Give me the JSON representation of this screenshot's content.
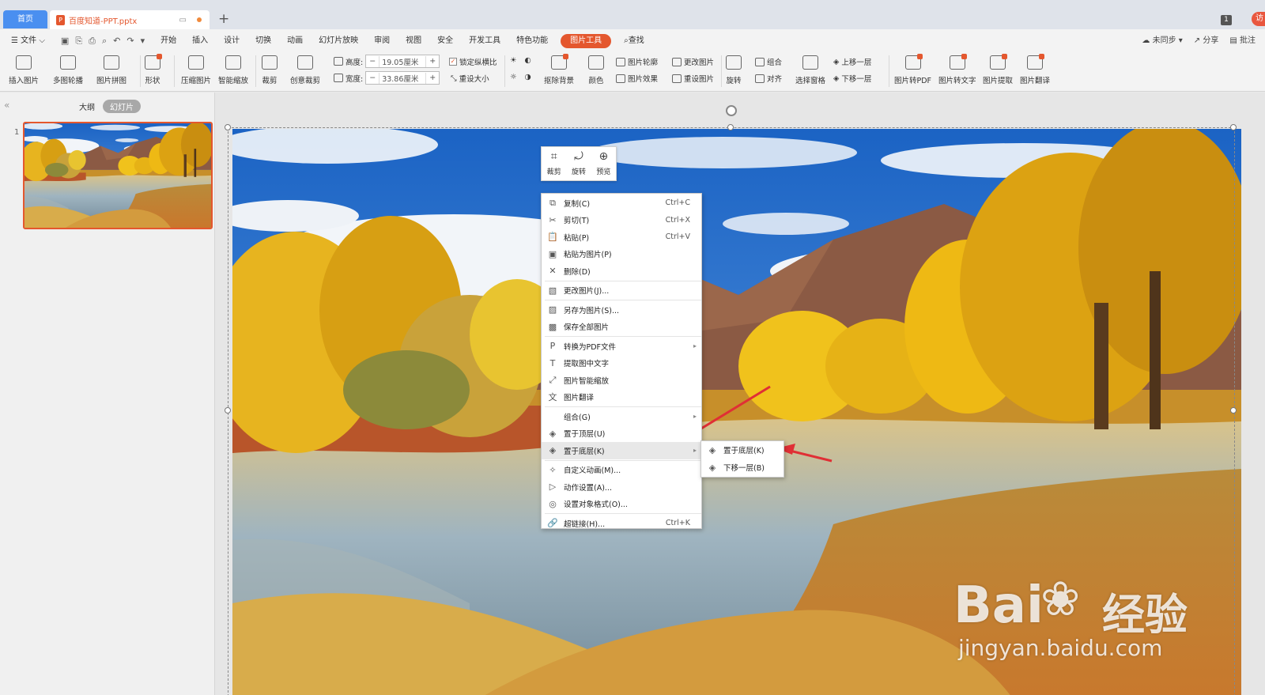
{
  "tabs": {
    "home": "首页",
    "doc": "百度知道-PPT.pptx",
    "add": "+"
  },
  "window": {
    "badge": "1",
    "visit": "访"
  },
  "menubar": {
    "file": "文件",
    "items": [
      "开始",
      "插入",
      "设计",
      "切换",
      "动画",
      "幻灯片放映",
      "审阅",
      "视图",
      "安全",
      "开发工具",
      "特色功能"
    ],
    "active": "图片工具",
    "search": "查找",
    "sync": "未同步",
    "share": "分享",
    "comment": "批注"
  },
  "ribbon": {
    "b1": "插入图片",
    "b2": "多图轮播",
    "b3": "图片拼图",
    "b4": "形状",
    "b5": "压缩图片",
    "b6": "智能缩放",
    "b7": "裁剪",
    "b8": "创意裁剪",
    "height_label": "高度:",
    "height_value": "19.05厘米",
    "width_label": "宽度:",
    "width_value": "33.86厘米",
    "lock": "锁定纵横比",
    "reset_size": "重设大小",
    "remove_bg": "抠除背景",
    "color": "颜色",
    "outline": "图片轮廓",
    "effect": "图片效果",
    "change": "更改图片",
    "reset": "重设图片",
    "rotate": "旋转",
    "group": "组合",
    "align": "对齐",
    "select_pane": "选择窗格",
    "up": "上移一层",
    "down": "下移一层",
    "to_pdf": "图片转PDF",
    "to_text": "图片转文字",
    "extract": "图片提取",
    "translate": "图片翻译"
  },
  "panel": {
    "outline": "大纲",
    "slides": "幻灯片",
    "slide_num": "1"
  },
  "minitoolbar": {
    "crop": "裁剪",
    "rotate": "旋转",
    "preview": "预览"
  },
  "context_menu": [
    {
      "label": "复制(C)",
      "shortcut": "Ctrl+C",
      "icon": "copy-icon",
      "glyph": "⧉"
    },
    {
      "label": "剪切(T)",
      "shortcut": "Ctrl+X",
      "icon": "scissors-icon",
      "glyph": "✂"
    },
    {
      "label": "粘贴(P)",
      "shortcut": "Ctrl+V",
      "icon": "paste-icon",
      "glyph": "📋"
    },
    {
      "label": "粘贴为图片(P)",
      "shortcut": "",
      "icon": "paste-image-icon",
      "glyph": "▣"
    },
    {
      "label": "删除(D)",
      "shortcut": "",
      "icon": "delete-icon",
      "glyph": "✕"
    },
    {
      "label": "更改图片(J)...",
      "shortcut": "",
      "icon": "change-image-icon",
      "glyph": "▧",
      "sep": true
    },
    {
      "label": "另存为图片(S)...",
      "shortcut": "",
      "icon": "save-as-image-icon",
      "glyph": "▨",
      "sep": true
    },
    {
      "label": "保存全部图片",
      "shortcut": "",
      "icon": "save-all-images-icon",
      "glyph": "▩"
    },
    {
      "label": "转换为PDF文件",
      "shortcut": "",
      "icon": "pdf-icon",
      "glyph": "P",
      "sub": true,
      "sep": true
    },
    {
      "label": "提取图中文字",
      "shortcut": "",
      "icon": "extract-text-icon",
      "glyph": "T"
    },
    {
      "label": "图片智能缩放",
      "shortcut": "",
      "icon": "smart-scale-icon",
      "glyph": "⤢"
    },
    {
      "label": "图片翻译",
      "shortcut": "",
      "icon": "translate-icon",
      "glyph": "文"
    },
    {
      "label": "组合(G)",
      "shortcut": "",
      "icon": "group-icon",
      "glyph": "",
      "sub": true,
      "sep": true
    },
    {
      "label": "置于顶层(U)",
      "shortcut": "",
      "icon": "bring-to-front-icon",
      "glyph": "◈"
    },
    {
      "label": "置于底层(K)",
      "shortcut": "",
      "icon": "send-to-back-icon",
      "glyph": "◈",
      "sub": true,
      "hl": true
    },
    {
      "label": "自定义动画(M)...",
      "shortcut": "",
      "icon": "animation-icon",
      "glyph": "✧",
      "sep": true
    },
    {
      "label": "动作设置(A)...",
      "shortcut": "",
      "icon": "action-icon",
      "glyph": "▷"
    },
    {
      "label": "设置对象格式(O)...",
      "shortcut": "",
      "icon": "format-icon",
      "glyph": "◎"
    },
    {
      "label": "超链接(H)...",
      "shortcut": "Ctrl+K",
      "icon": "hyperlink-icon",
      "glyph": "🔗",
      "sep": true
    }
  ],
  "submenu": [
    {
      "label": "置于底层(K)",
      "icon": "send-to-back-icon",
      "glyph": "◈"
    },
    {
      "label": "下移一层(B)",
      "icon": "send-backward-icon",
      "glyph": "◈"
    }
  ],
  "watermark": {
    "logo": "Bai",
    "logo2": "经验",
    "url": "jingyan.baidu.com"
  },
  "colors": {
    "accent": "#e4572e",
    "arrow": "#e02f35"
  }
}
